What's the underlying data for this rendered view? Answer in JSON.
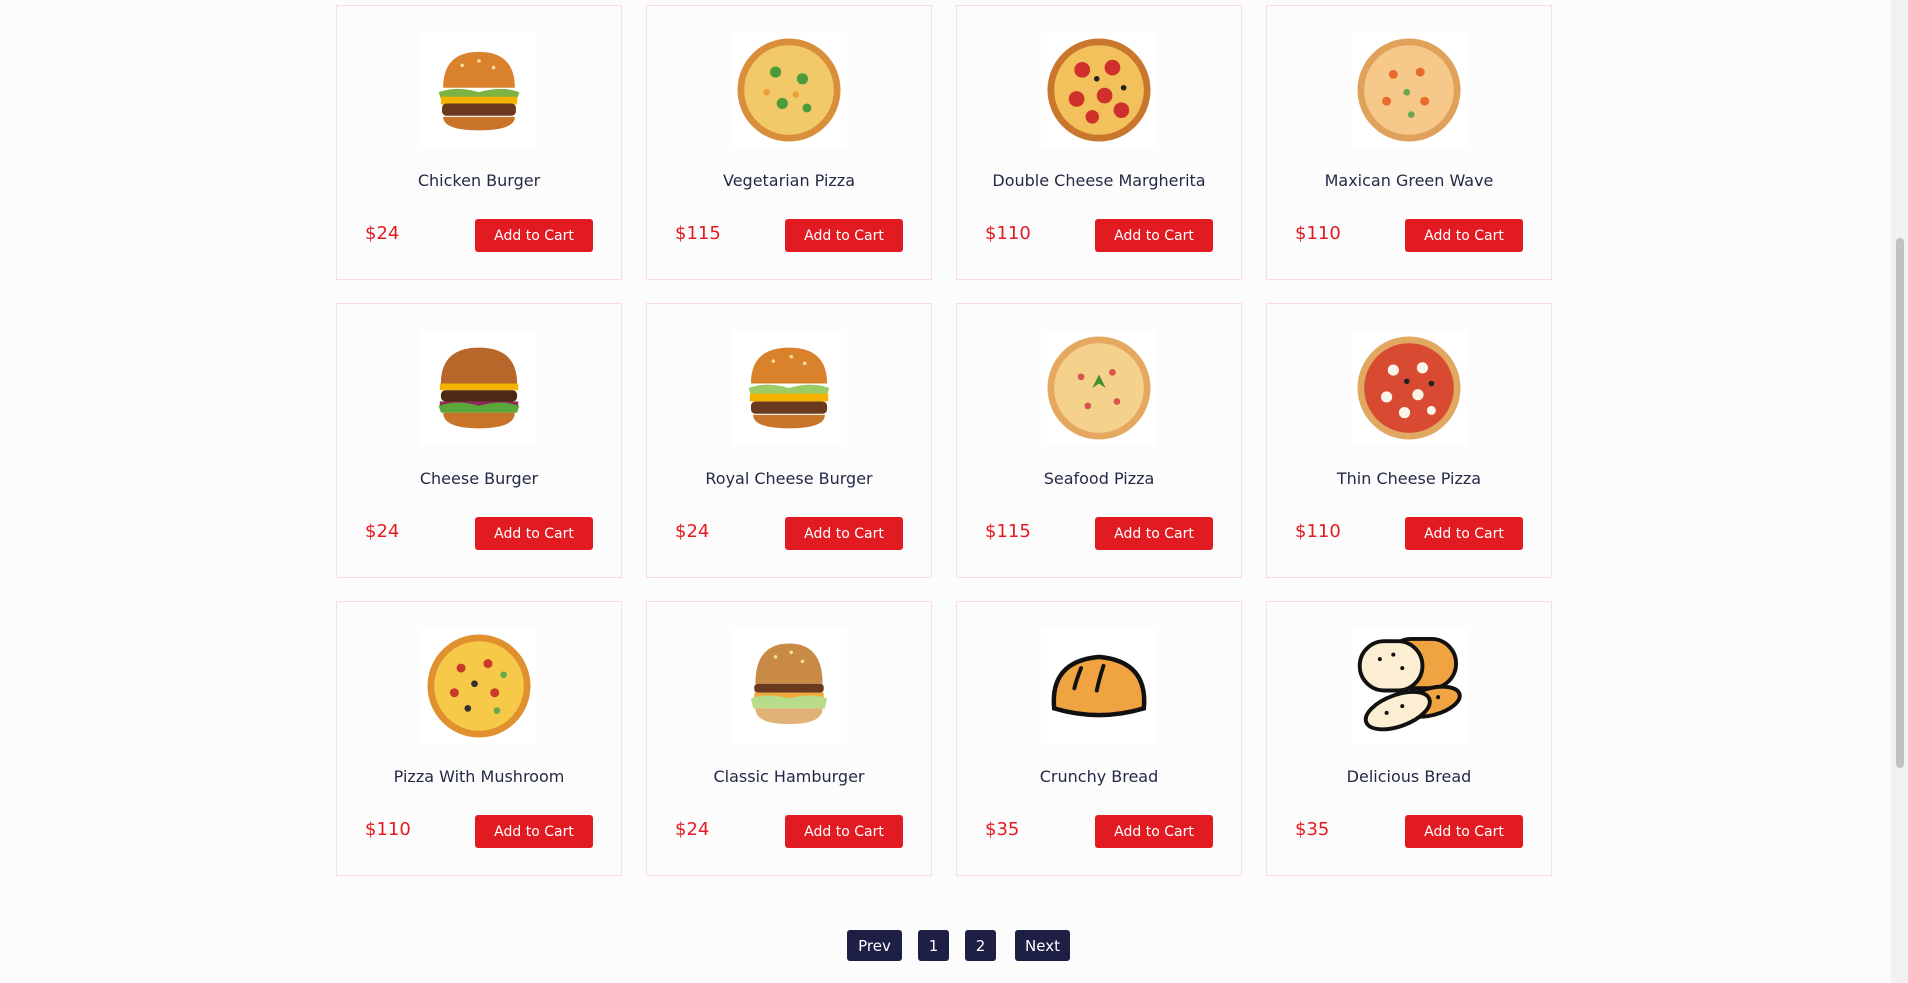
{
  "products": [
    {
      "name": "Chicken Burger",
      "price": "$24",
      "icon": "burger-icon"
    },
    {
      "name": "Vegetarian Pizza",
      "price": "$115",
      "icon": "pizza-icon"
    },
    {
      "name": "Double Cheese Margherita",
      "price": "$110",
      "icon": "pizza-icon"
    },
    {
      "name": "Maxican Green Wave",
      "price": "$110",
      "icon": "pizza-icon"
    },
    {
      "name": "Cheese Burger",
      "price": "$24",
      "icon": "burger-icon"
    },
    {
      "name": "Royal Cheese Burger",
      "price": "$24",
      "icon": "burger-icon"
    },
    {
      "name": "Seafood Pizza",
      "price": "$115",
      "icon": "pizza-icon"
    },
    {
      "name": "Thin Cheese Pizza",
      "price": "$110",
      "icon": "pizza-icon"
    },
    {
      "name": "Pizza With Mushroom",
      "price": "$110",
      "icon": "pizza-icon"
    },
    {
      "name": "Classic Hamburger",
      "price": "$24",
      "icon": "burger-icon"
    },
    {
      "name": "Crunchy Bread",
      "price": "$35",
      "icon": "bread-icon"
    },
    {
      "name": "Delicious Bread",
      "price": "$35",
      "icon": "bread-slices-icon"
    }
  ],
  "add_to_cart_label": "Add to Cart",
  "pagination": {
    "prev": "Prev",
    "pages": [
      "1",
      "2"
    ],
    "next": "Next"
  },
  "colors": {
    "accent": "#e21b23",
    "pager": "#1d1f45",
    "title": "#232a45",
    "card_border": "#fadde1"
  }
}
